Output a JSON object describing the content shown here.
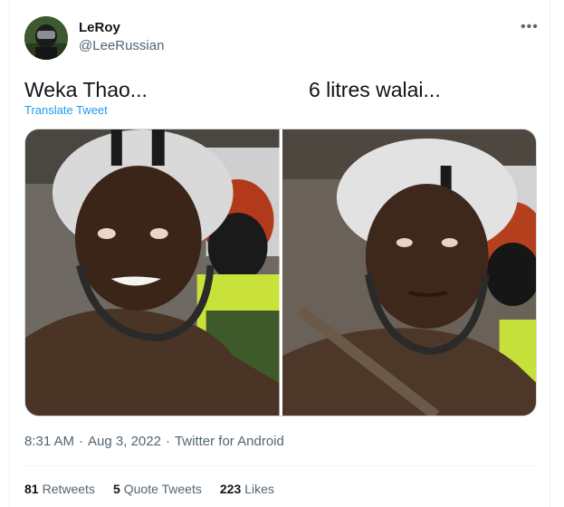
{
  "user": {
    "name": "LeRoy",
    "handle": "@LeeRussian"
  },
  "more_icon": "ellipsis-icon",
  "tweet": {
    "text_left": "Weka Thao...",
    "text_right": "6 litres walai...",
    "translate_label": "Translate Tweet"
  },
  "media": {
    "count": 2
  },
  "meta": {
    "time": "8:31 AM",
    "date": "Aug 3, 2022",
    "source": "Twitter for Android",
    "separator": "·"
  },
  "stats": {
    "retweets_count": "81",
    "retweets_label": "Retweets",
    "quotes_count": "5",
    "quotes_label": "Quote Tweets",
    "likes_count": "223",
    "likes_label": "Likes"
  },
  "colors": {
    "link": "#1d9bf0",
    "secondary_text": "#536471",
    "border": "#eff3f4"
  }
}
